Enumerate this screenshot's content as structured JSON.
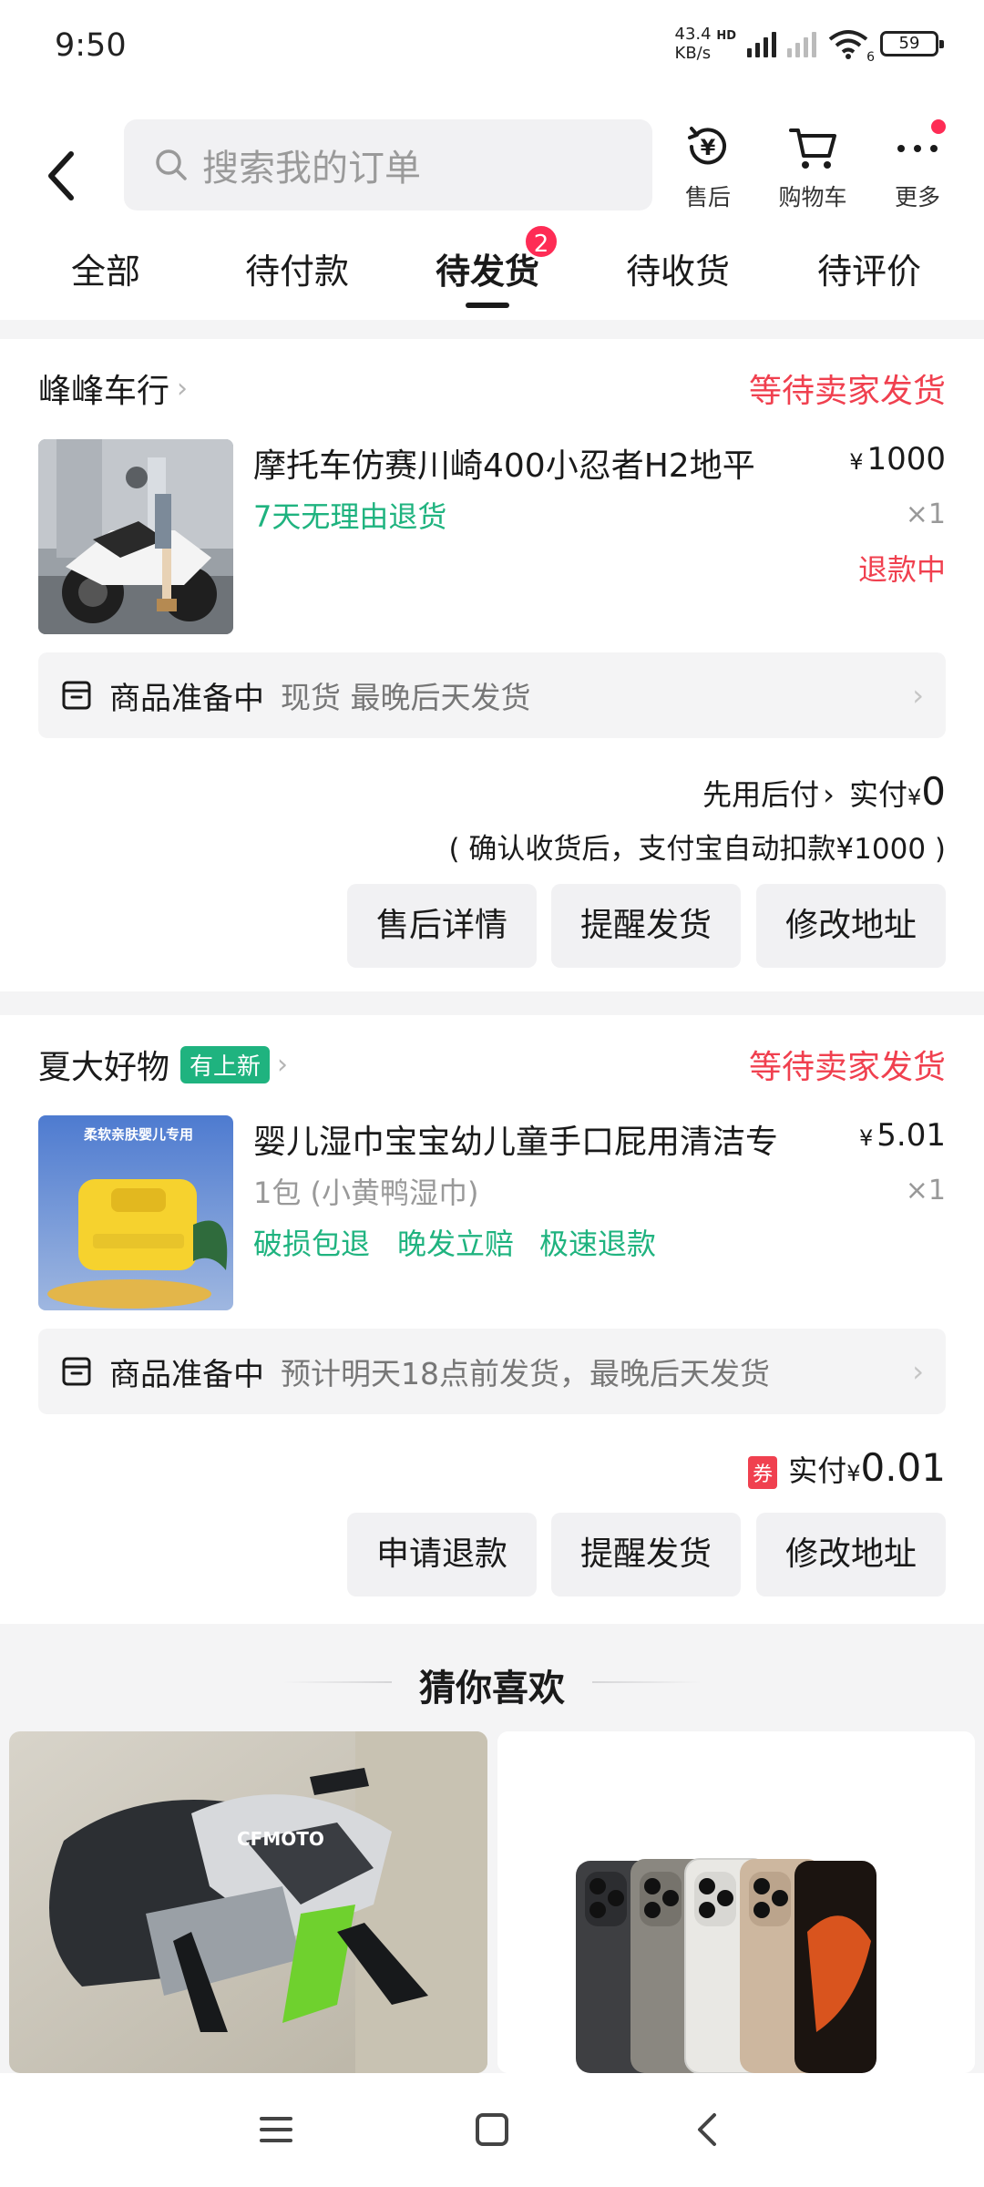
{
  "status_bar": {
    "time": "9:50",
    "net_speed_value": "43.4",
    "net_speed_unit": "KB/s",
    "hd": "HD",
    "wifi_badge": "6",
    "battery": "59"
  },
  "header": {
    "search_placeholder": "搜索我的订单",
    "icons": [
      {
        "label": "售后",
        "icon": "after-sale-icon"
      },
      {
        "label": "购物车",
        "icon": "cart-icon"
      },
      {
        "label": "更多",
        "icon": "more-icon"
      }
    ]
  },
  "tabs": [
    {
      "label": "全部"
    },
    {
      "label": "待付款"
    },
    {
      "label": "待发货",
      "active": true,
      "badge": "2"
    },
    {
      "label": "待收货"
    },
    {
      "label": "待评价"
    }
  ],
  "orders": [
    {
      "shop": "峰峰车行",
      "status": "等待卖家发货",
      "title": "摩托车仿赛川崎400小忍者H2地平",
      "tag": "7天无理由退货",
      "price_symbol": "¥",
      "price": "1000",
      "qty": "×1",
      "refund_status": "退款中",
      "prep_main": "商品准备中",
      "prep_detail": "现货 最晚后天发货",
      "pay_prefix": "先用后付",
      "pay_label": "实付",
      "pay_symbol": "¥",
      "pay_amount": "0",
      "pay_note": "( 确认收货后，支付宝自动扣款¥1000 )",
      "buttons": [
        "售后详情",
        "提醒发货",
        "修改地址"
      ]
    },
    {
      "shop": "夏大好物",
      "shop_badge": "有上新",
      "status": "等待卖家发货",
      "title": "婴儿湿巾宝宝幼儿童手口屁用清洁专",
      "variant": "1包 (小黄鸭湿巾)",
      "tags": [
        "破损包退",
        "晚发立赔",
        "极速退款"
      ],
      "price_symbol": "¥",
      "price": "5.01",
      "qty": "×1",
      "thumb_caption": "柔软亲肤婴儿专用",
      "prep_main": "商品准备中",
      "prep_detail": "预计明天18点前发货，最晚后天发货",
      "coupon": "券",
      "pay_label": "实付",
      "pay_symbol": "¥",
      "pay_amount": "0.01",
      "buttons": [
        "申请退款",
        "提醒发货",
        "修改地址"
      ]
    }
  ],
  "recommend": {
    "title": "猜你喜欢",
    "moto_brand": "CFMOTO"
  },
  "colors": {
    "accent_red": "#f0404f",
    "teal": "#1fb37f",
    "badge_red": "#fe2c55"
  }
}
